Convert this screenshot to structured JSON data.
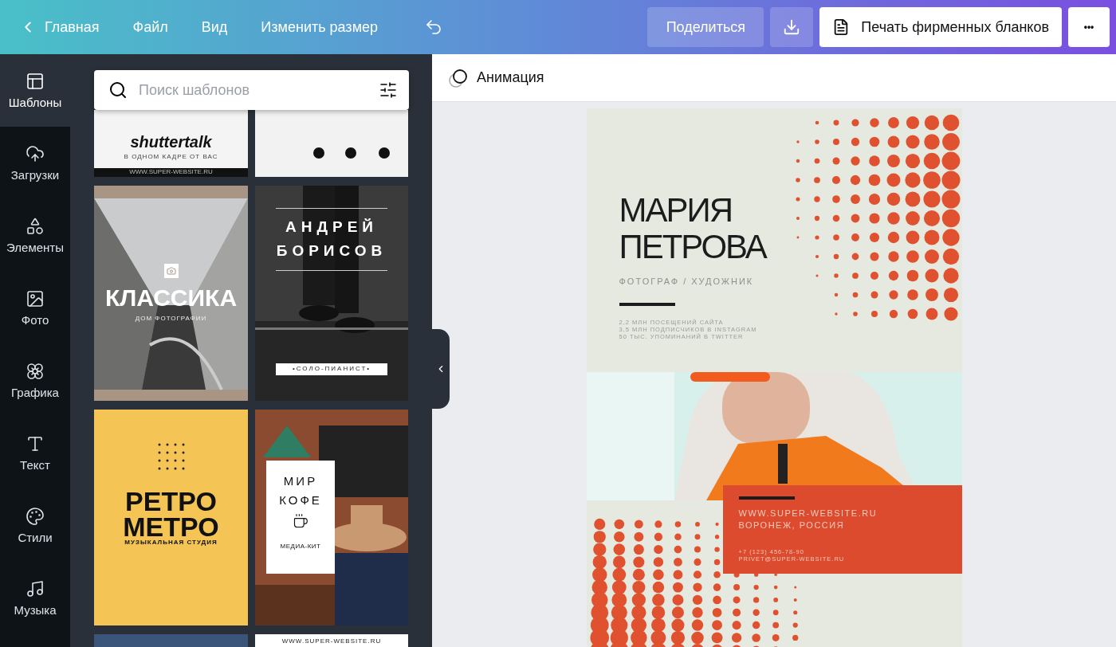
{
  "topbar": {
    "back": "Главная",
    "menu": [
      "Файл",
      "Вид",
      "Изменить размер"
    ],
    "share": "Поделиться",
    "print": "Печать фирменных бланков",
    "more": "•••"
  },
  "rail": [
    {
      "label": "Шаблоны",
      "selected": true
    },
    {
      "label": "Загрузки",
      "selected": false
    },
    {
      "label": "Элементы",
      "selected": false
    },
    {
      "label": "Фото",
      "selected": false
    },
    {
      "label": "Графика",
      "selected": false
    },
    {
      "label": "Текст",
      "selected": false
    },
    {
      "label": "Стили",
      "selected": false
    },
    {
      "label": "Музыка",
      "selected": false
    }
  ],
  "search": {
    "placeholder": "Поиск шаблонов"
  },
  "templates": [
    {
      "kind": "shutter",
      "title": "shuttertalk",
      "subtitle": "В ОДНОМ КАДРЕ ОТ ВАС",
      "footer": "WWW.SUPER-WEBSITE.RU"
    },
    {
      "kind": "social"
    },
    {
      "kind": "classic",
      "title": "КЛАССИКА",
      "subtitle": "ДОМ ФОТОГРАФИИ"
    },
    {
      "kind": "pianist",
      "title": "АНДРЕЙ БОРИСОВ",
      "subtitle": "•СОЛО-ПИАНИСТ•"
    },
    {
      "kind": "retro",
      "title": "РЕТРО МЕТРО",
      "subtitle": "МУЗЫКАЛЬНАЯ СТУДИЯ"
    },
    {
      "kind": "coffee",
      "title": "МИР КОФЕ",
      "subtitle": "МЕДИА-КИТ"
    },
    {
      "kind": "blue"
    },
    {
      "kind": "plain",
      "footer": "WWW.SUPER-WEBSITE.RU"
    }
  ],
  "canvas": {
    "animation": "Анимация"
  },
  "design": {
    "name": [
      "МАРИЯ",
      "ПЕТРОВА"
    ],
    "role": "ФОТОГРАФ / ХУДОЖНИК",
    "stats": [
      "2,2 МЛН ПОСЕЩЕНИЙ САЙТА",
      "3,5 МЛН ПОДПИСЧИКОВ В INSTAGRAM",
      "50 ТЫС. УПОМИНАНИЙ В TWITTER"
    ],
    "site": [
      "WWW.SUPER-WEBSITE.RU",
      "ВОРОНЕЖ, РОССИЯ"
    ],
    "contacts": [
      "+7 (123) 456-78-90",
      "PRIVET@SUPER-WEBSITE.RU"
    ]
  }
}
